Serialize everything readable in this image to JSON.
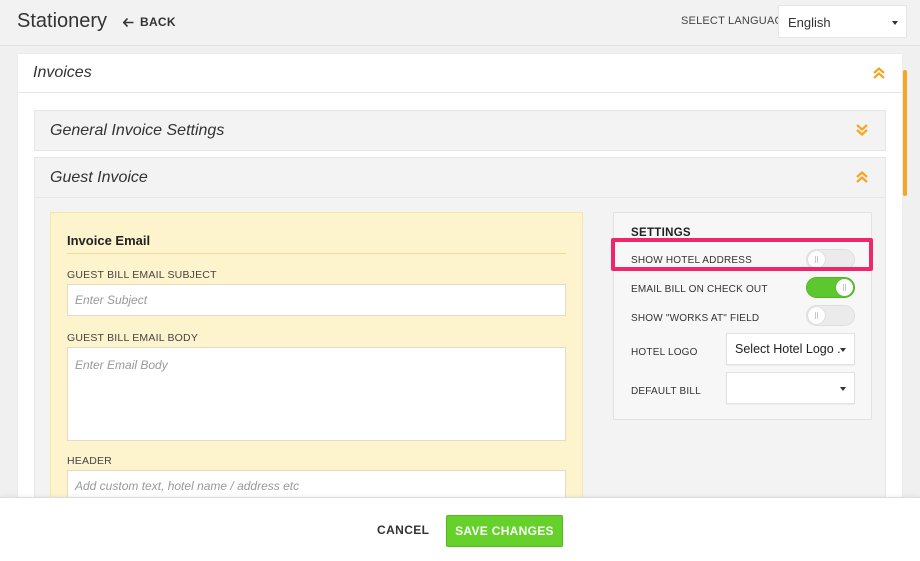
{
  "header": {
    "title": "Stationery",
    "back_label": "BACK",
    "language_label": "SELECT LANGUAGE",
    "language_value": "English"
  },
  "invoices": {
    "title": "Invoices",
    "sections": {
      "general": {
        "title": "General Invoice Settings"
      },
      "guest": {
        "title": "Guest Invoice"
      }
    }
  },
  "invoice_email": {
    "title": "Invoice Email",
    "subject_label": "GUEST BILL EMAIL SUBJECT",
    "subject_placeholder": "Enter Subject",
    "body_label": "GUEST BILL EMAIL BODY",
    "body_placeholder": "Enter Email Body",
    "header_label": "HEADER",
    "header_placeholder": "Add custom text, hotel name / address etc"
  },
  "settings": {
    "title": "SETTINGS",
    "toggles": [
      {
        "label": "SHOW HOTEL ADDRESS",
        "on": false
      },
      {
        "label": "EMAIL BILL ON CHECK OUT",
        "on": true
      },
      {
        "label": "SHOW \"WORKS AT\" FIELD",
        "on": false
      }
    ],
    "hotel_logo_label": "HOTEL LOGO",
    "hotel_logo_value": "Select Hotel Logo .",
    "default_bill_label": "DEFAULT BILL",
    "default_bill_value": ""
  },
  "footer": {
    "cancel_label": "CANCEL",
    "save_label": "SAVE CHANGES"
  },
  "colors": {
    "accent": "#f5a623",
    "toggle_on": "#5cc72f",
    "save_button": "#66d12a",
    "highlight": "#f0266b",
    "email_card": "#fdf3cd"
  },
  "icons": {
    "back": "arrow-left-icon",
    "collapse": "chevron-double-up-icon",
    "expand": "chevron-double-down-icon",
    "dropdown": "caret-down-icon"
  }
}
